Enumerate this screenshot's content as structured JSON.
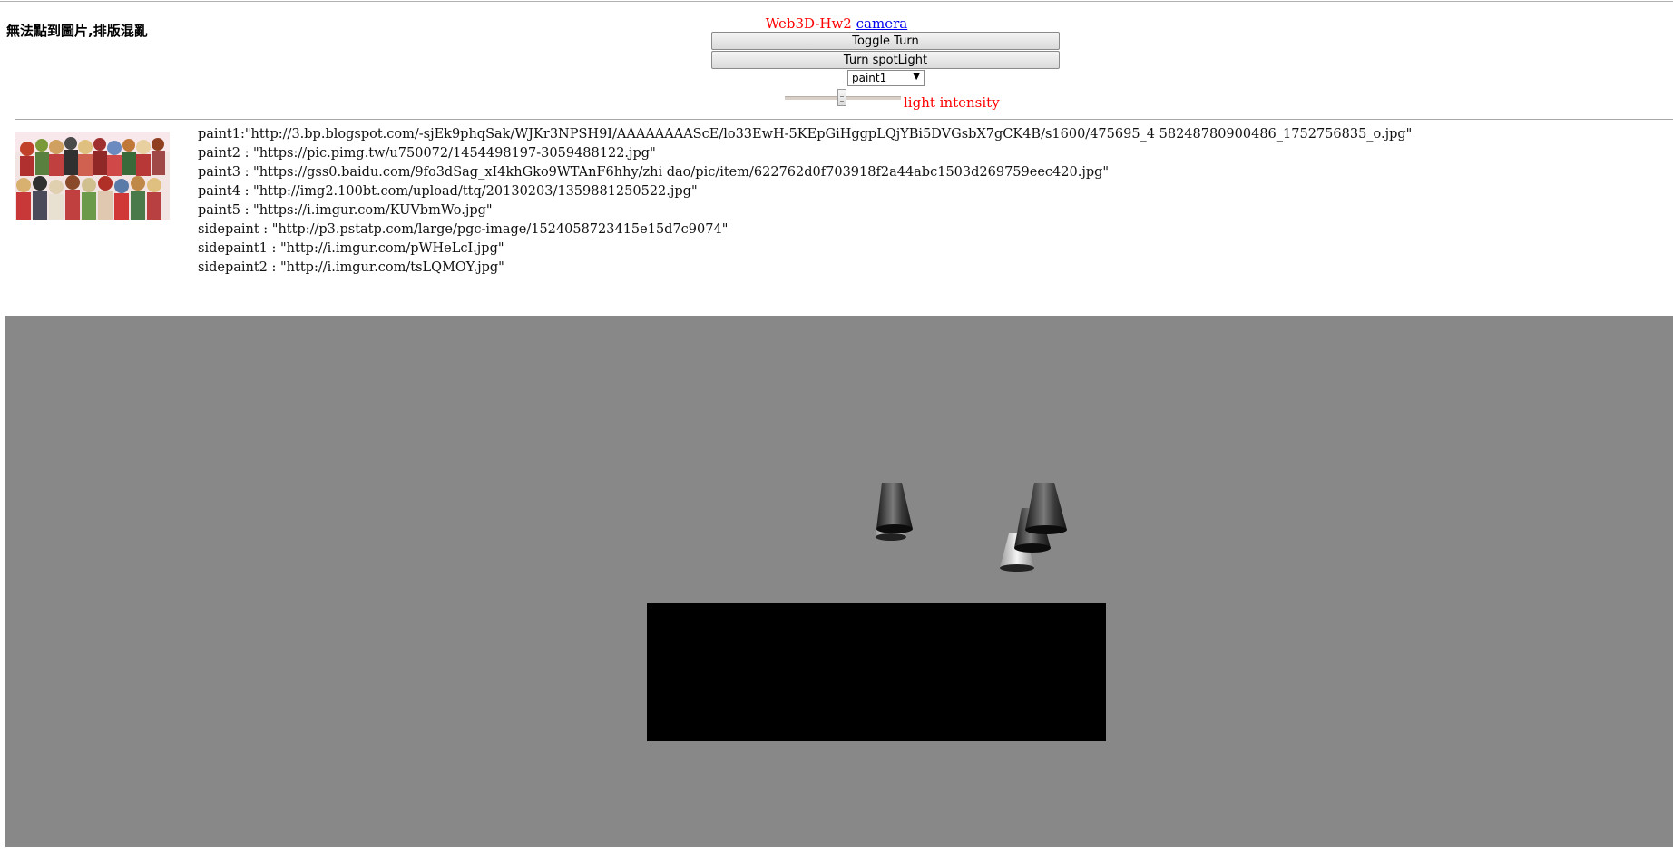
{
  "warning": "無法點到圖片,排版混亂",
  "header": {
    "title": "Web3D-Hw2",
    "camera_link": "camera"
  },
  "controls": {
    "toggle_turn": "Toggle Turn",
    "turn_spotlight": "Turn spotLight",
    "paint_select": "paint1",
    "light_intensity_label": "light intensity",
    "light_intensity_value": 0.5
  },
  "paints": [
    {
      "label": "paint1:\"http://3.bp.blogspot.com/-sjEk9phqSak/WJKr3NPSH9I/AAAAAAAAScE/lo33EwH-5KEpGiHggpLQjYBi5DVGsbX7gCK4B/s1600/475695_4 58248780900486_1752756835_o.jpg\""
    },
    {
      "label": "paint2 : \"https://pic.pimg.tw/u750072/1454498197-3059488122.jpg\""
    },
    {
      "label": "paint3 : \"https://gss0.baidu.com/9fo3dSag_xI4khGko9WTAnF6hhy/zhi dao/pic/item/622762d0f703918f2a44abc1503d269759eec420.jpg\""
    },
    {
      "label": "paint4 : \"http://img2.100bt.com/upload/ttq/20130203/1359881250522.jpg\""
    },
    {
      "label": "paint5 : \"https://i.imgur.com/KUVbmWo.jpg\""
    },
    {
      "label": "sidepaint : \"http://p3.pstatp.com/large/pgc-image/1524058723415e15d7c9074\""
    },
    {
      "label": "sidepaint1 : \"http://i.imgur.com/pWHeLcI.jpg\""
    },
    {
      "label": "sidepaint2 : \"http://i.imgur.com/tsLQMOY.jpg\""
    }
  ],
  "colors": {
    "title": "#ff0000",
    "link": "#0000ee",
    "canvas_bg": "#888888",
    "screen": "#000000"
  }
}
